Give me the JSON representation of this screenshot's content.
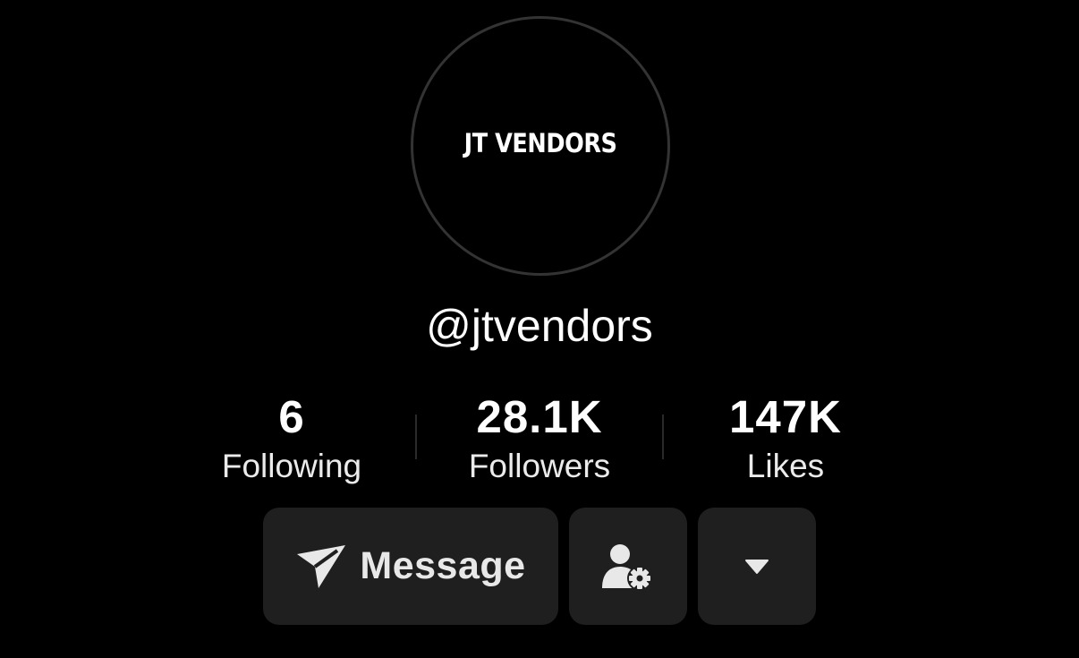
{
  "profile": {
    "avatar_text": "JT VENDORS",
    "username": "@jtvendors"
  },
  "stats": [
    {
      "value": "6",
      "label": "Following"
    },
    {
      "value": "28.1K",
      "label": "Followers"
    },
    {
      "value": "147K",
      "label": "Likes"
    }
  ],
  "actions": {
    "message_label": "Message",
    "message_icon": "send-icon",
    "friend_settings_icon": "user-gear-icon",
    "more_icon": "caret-down-icon"
  },
  "colors": {
    "background": "#000000",
    "button_bg": "#1f1f1f",
    "text": "#ffffff"
  }
}
